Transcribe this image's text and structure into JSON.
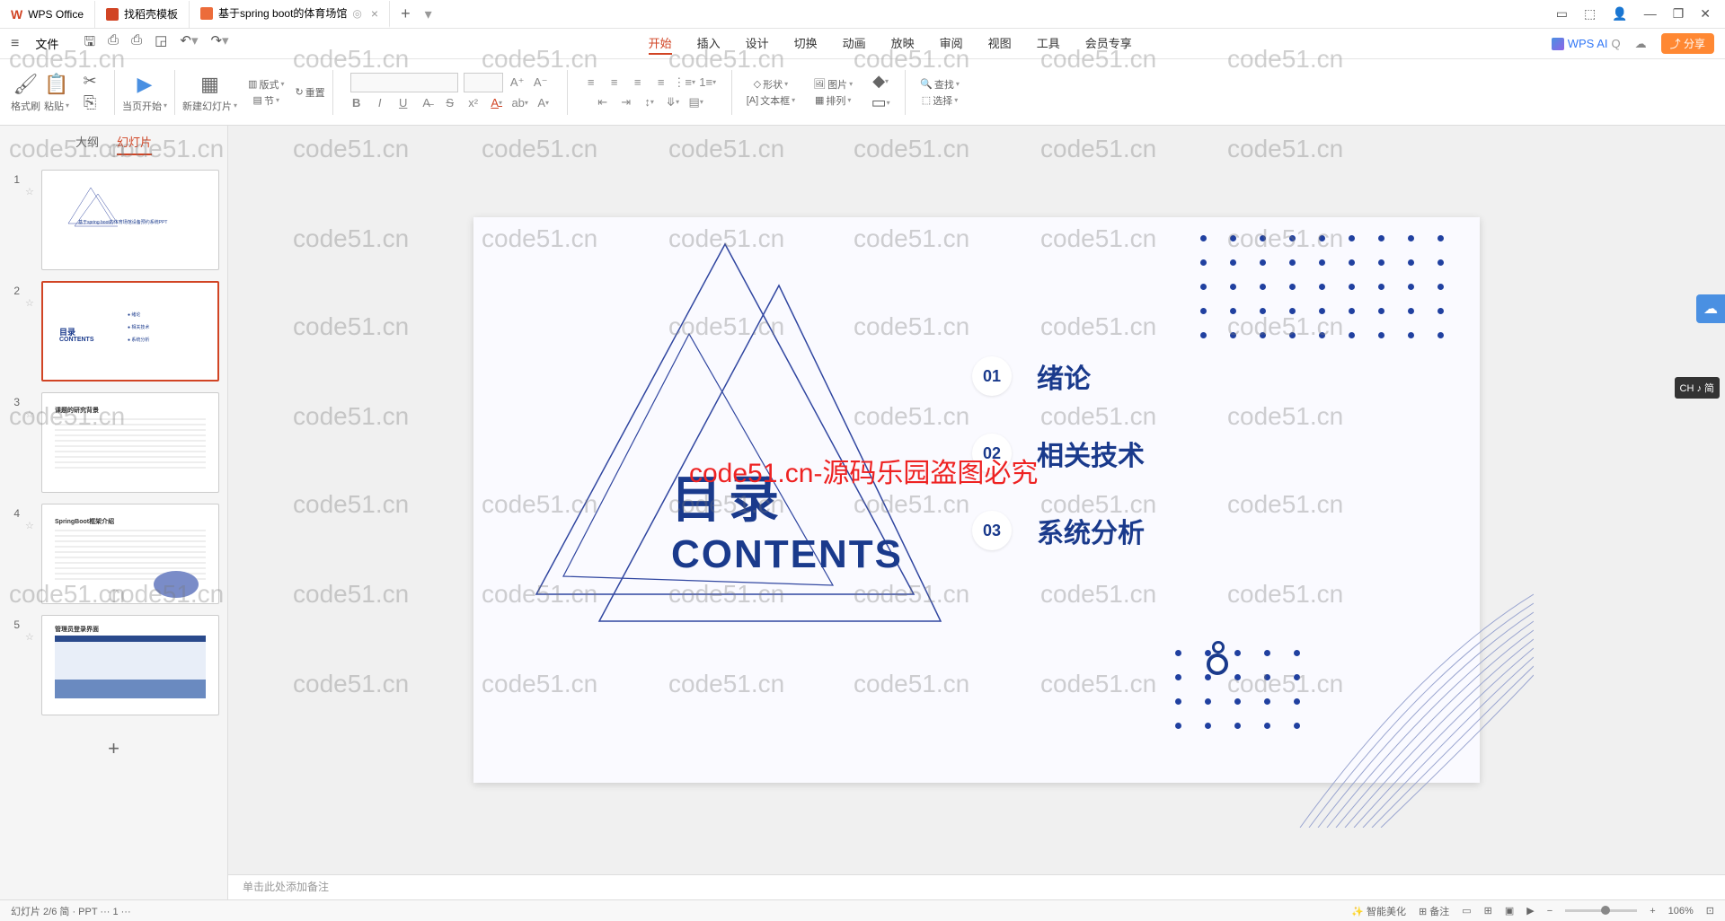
{
  "app": {
    "name": "WPS Office"
  },
  "tabs": [
    {
      "label": "WPS Office"
    },
    {
      "label": "找稻壳模板"
    },
    {
      "label": "基于spring boot的体育场馆"
    }
  ],
  "menu": {
    "file": "文件",
    "items": [
      "开始",
      "插入",
      "设计",
      "切换",
      "动画",
      "放映",
      "审阅",
      "视图",
      "工具",
      "会员专享"
    ],
    "wps_ai": "WPS AI",
    "share": "分享"
  },
  "ribbon": {
    "format_painter": "格式刷",
    "paste": "粘贴",
    "from_current": "当页开始",
    "new_slide": "新建幻灯片",
    "layout": "版式",
    "section": "节",
    "reset": "重置",
    "shape": "形状",
    "picture": "图片",
    "textbox": "文本框",
    "arrange": "排列",
    "find": "查找",
    "select": "选择"
  },
  "side": {
    "outline": "大纲",
    "slides": "幻灯片"
  },
  "thumbs": [
    "1",
    "2",
    "3",
    "4",
    "5"
  ],
  "thumb_titles": {
    "t1": "基于spring boot的体育场馆设备预约系统PPT",
    "t2_title": "目录",
    "t2_en": "CONTENTS",
    "t2_i1": "绪论",
    "t2_i2": "相关技术",
    "t2_i3": "系统分析",
    "t3": "课题的研究背景",
    "t4": "SpringBoot框架介绍",
    "t5": "管理员登录界面"
  },
  "slide": {
    "title_cn": "目录",
    "title_en": "CONTENTS",
    "items": [
      {
        "num": "01",
        "label": "绪论"
      },
      {
        "num": "02",
        "label": "相关技术"
      },
      {
        "num": "03",
        "label": "系统分析"
      }
    ],
    "watermark_red": "code51.cn-源码乐园盗图必究"
  },
  "notes": {
    "placeholder": "单击此处添加备注"
  },
  "status": {
    "left": "幻灯片 2/6    简 · PPT    ···    1    ···",
    "smart": "智能美化",
    "notes": "备注",
    "zoom": "106%"
  },
  "ime": "CH ♪ 简",
  "watermark": "code51.cn"
}
